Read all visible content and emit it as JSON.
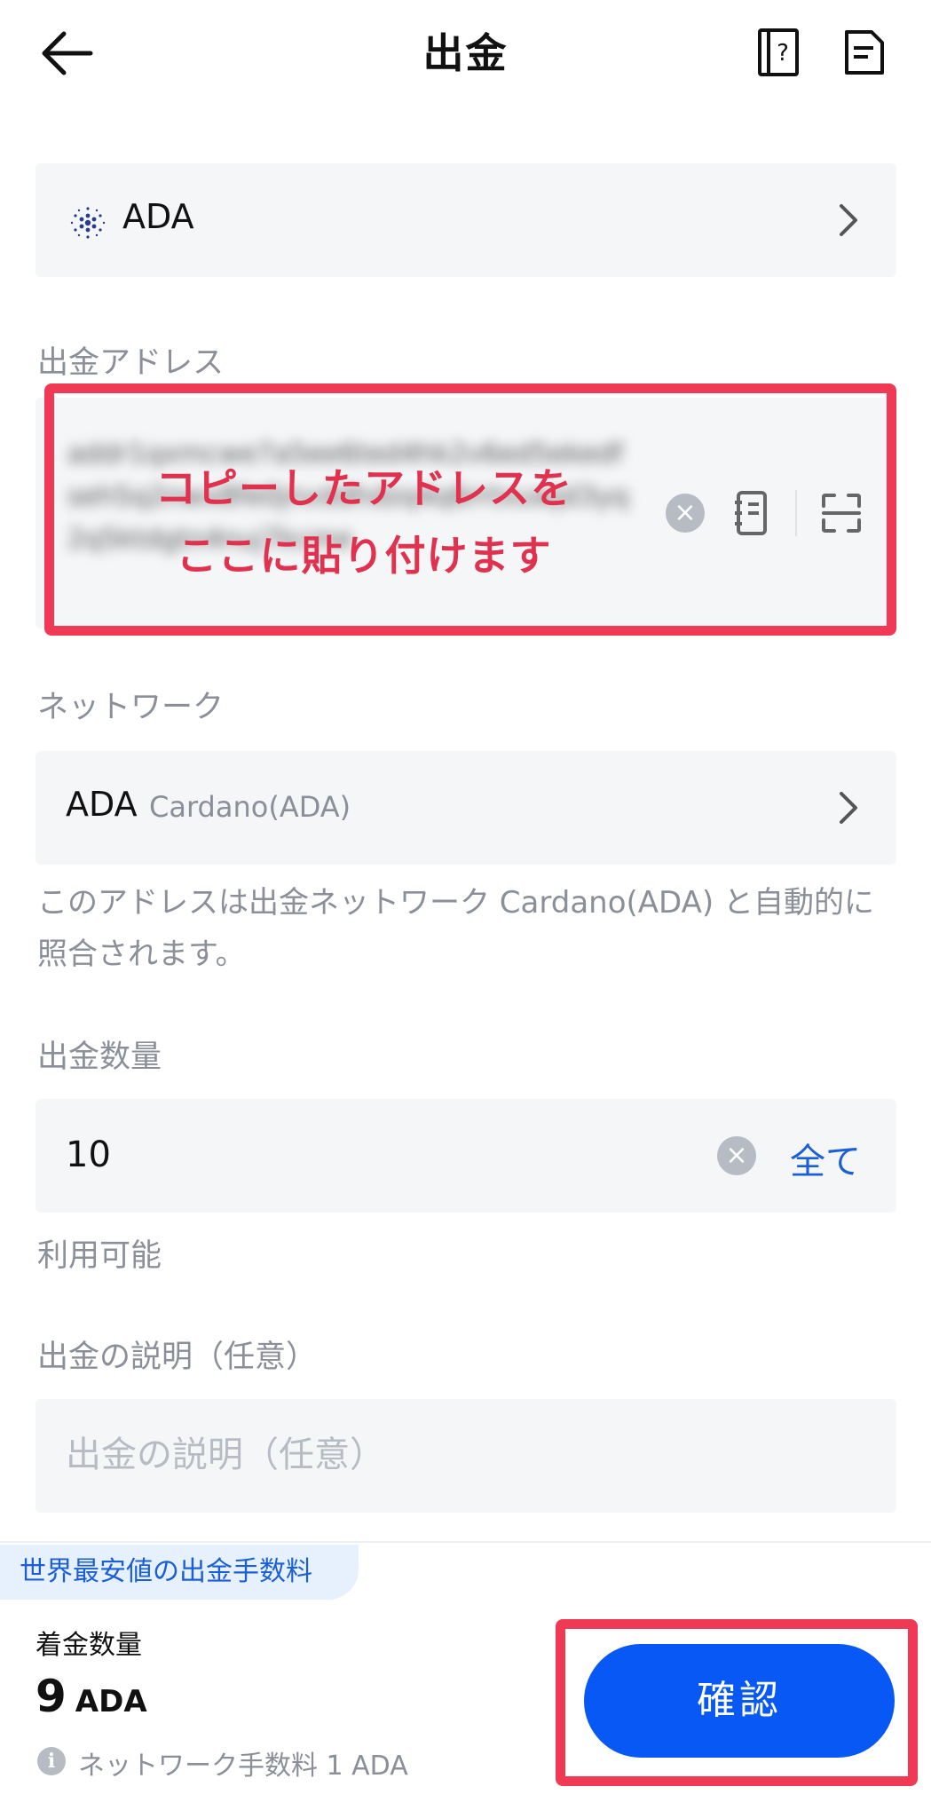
{
  "header": {
    "title": "出金",
    "back_icon": "arrow-left-icon",
    "help_icon": "help-book-icon",
    "record_icon": "document-icon"
  },
  "coin": {
    "symbol": "ADA",
    "logo_icon": "cardano-logo-icon"
  },
  "address": {
    "label": "出金アドレス",
    "value_blurred": "addr1qxmcwe7a5ee6ted4hk2v6ed5ekedfseh5q2nwx8fe0jnvddhdzq4q6rrtxuwjd3yq2q5ktdgtn4nuj7kcme",
    "overlay_line1": "コピーしたアドレスを",
    "overlay_line2": "ここに貼り付けます"
  },
  "network": {
    "label": "ネットワーク",
    "ticker": "ADA",
    "name": "Cardano(ADA)",
    "note": "このアドレスは出金ネットワーク Cardano(ADA) と自動的に照合されます。"
  },
  "amount": {
    "label": "出金数量",
    "value": "10",
    "all_label": "全て",
    "available_label": "利用可能"
  },
  "memo": {
    "label": "出金の説明（任意）",
    "placeholder": "出金の説明（任意）"
  },
  "bottom": {
    "promo": "世界最安値の出金手数料",
    "receive_label": "着金数量",
    "receive_amount": "9",
    "receive_unit": "ADA",
    "fee_text": "ネットワーク手数料 1 ADA",
    "confirm_label": "確認"
  },
  "colors": {
    "accent": "#0758f5",
    "link": "#1a5fd6",
    "annotation": "#f03a55",
    "field_bg": "#f5f6f8",
    "muted_text": "#8a8f99"
  }
}
